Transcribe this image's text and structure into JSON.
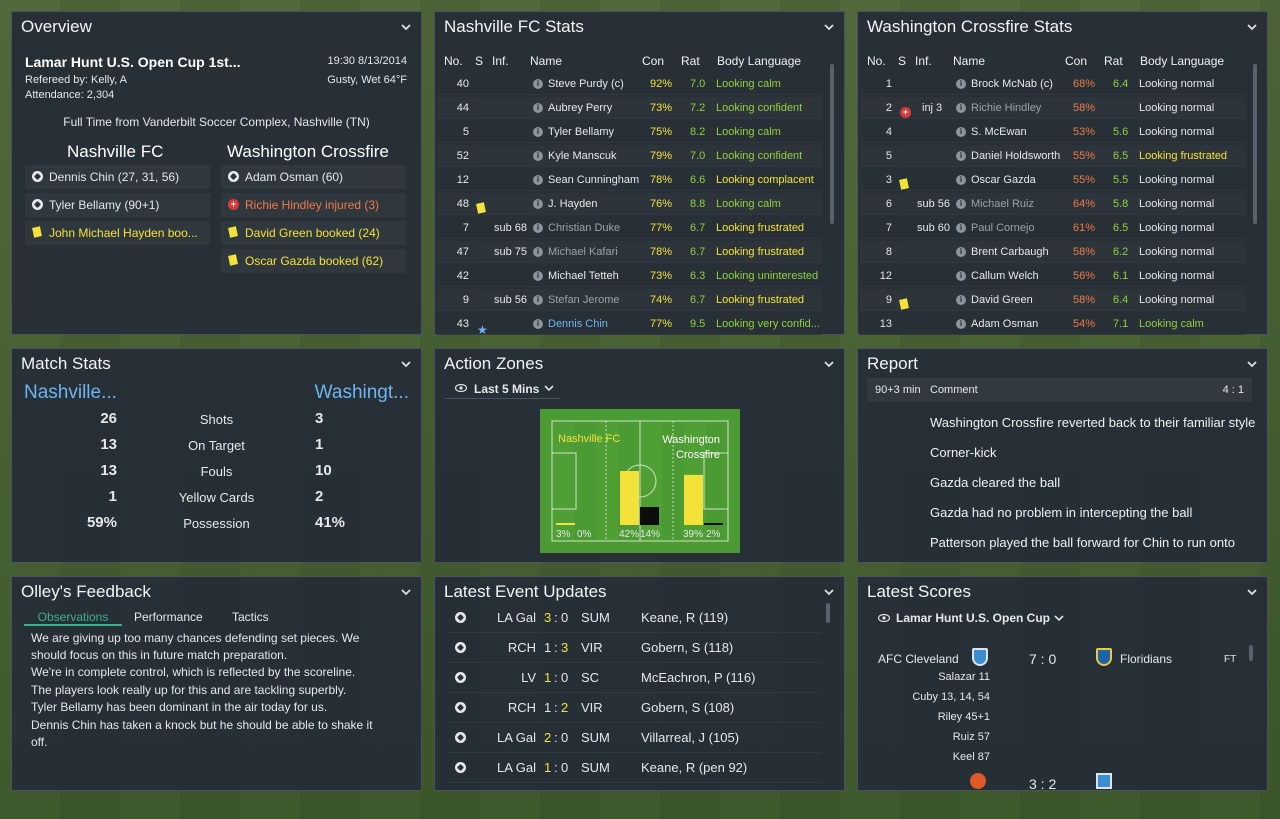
{
  "overview": {
    "title": "Overview",
    "competition": "Lamar Hunt U.S. Open Cup 1st...",
    "datetime": "19:30 8/13/2014",
    "referee": "Refereed by: Kelly, A",
    "weather": "Gusty, Wet 64°F",
    "attendance": "Attendance: 2,304",
    "result": "Full Time from Vanderbilt Soccer Complex, Nashville (TN)",
    "home_team": "Nashville FC",
    "away_team": "Washington Crossfire",
    "home_events": [
      {
        "icon": "ball-icon",
        "text": "Dennis Chin (27, 31, 56)"
      },
      {
        "icon": "ball-icon",
        "text": "Tyler Bellamy (90+1)"
      },
      {
        "icon": "yellow-card-icon",
        "text": "John Michael Hayden boo..."
      }
    ],
    "away_events": [
      {
        "icon": "ball-icon",
        "text": "Adam Osman (60)"
      },
      {
        "icon": "injury-icon",
        "text": "Richie Hindley injured (3)"
      },
      {
        "icon": "yellow-card-icon",
        "text": "David Green booked (24)"
      },
      {
        "icon": "yellow-card-icon",
        "text": "Oscar Gazda booked (62)"
      }
    ]
  },
  "columns": {
    "no": "No.",
    "s": "S",
    "inf": "Inf.",
    "name": "Name",
    "con": "Con",
    "rat": "Rat",
    "body": "Body Language"
  },
  "nashville_stats": {
    "title": "Nashville FC Stats",
    "rows": [
      {
        "no": "40",
        "s": "",
        "inf": "",
        "name": "Steve Purdy (c)",
        "con": "92%",
        "rat": "7.0",
        "body": "Looking calm",
        "sub": false
      },
      {
        "no": "44",
        "s": "",
        "inf": "",
        "name": "Aubrey Perry",
        "con": "73%",
        "rat": "7.2",
        "body": "Looking confident",
        "sub": false
      },
      {
        "no": "5",
        "s": "",
        "inf": "",
        "name": "Tyler Bellamy",
        "con": "75%",
        "rat": "8.2",
        "body": "Looking calm",
        "sub": false
      },
      {
        "no": "52",
        "s": "",
        "inf": "",
        "name": "Kyle Manscuk",
        "con": "79%",
        "rat": "7.0",
        "body": "Looking confident",
        "sub": false
      },
      {
        "no": "12",
        "s": "",
        "inf": "",
        "name": "Sean Cunningham",
        "con": "78%",
        "rat": "6.6",
        "body": "Looking complacent",
        "sub": false
      },
      {
        "no": "48",
        "s": "yellow-card-icon",
        "inf": "",
        "name": "J. Hayden",
        "con": "76%",
        "rat": "8.8",
        "body": "Looking calm",
        "sub": false
      },
      {
        "no": "7",
        "s": "",
        "inf": "sub 68",
        "name": "Christian Duke",
        "con": "77%",
        "rat": "6.7",
        "body": "Looking frustrated",
        "sub": true
      },
      {
        "no": "47",
        "s": "",
        "inf": "sub 75",
        "name": "Michael Kafari",
        "con": "78%",
        "rat": "6.7",
        "body": "Looking frustrated",
        "sub": true
      },
      {
        "no": "42",
        "s": "",
        "inf": "",
        "name": "Michael Tetteh",
        "con": "73%",
        "rat": "6.3",
        "body": "Looking uninterested",
        "sub": false
      },
      {
        "no": "9",
        "s": "",
        "inf": "sub 56",
        "name": "Stefan Jerome",
        "con": "74%",
        "rat": "6.7",
        "body": "Looking frustrated",
        "sub": true
      },
      {
        "no": "43",
        "s": "star-icon",
        "inf": "",
        "name": "Dennis Chin",
        "con": "77%",
        "rat": "9.5",
        "body": "Looking very confid...",
        "sub": false,
        "star": true
      }
    ]
  },
  "washington_stats": {
    "title": "Washington Crossfire Stats",
    "rows": [
      {
        "no": "1",
        "s": "",
        "inf": "",
        "name": "Brock McNab (c)",
        "con": "68%",
        "rat": "6.4",
        "body": "Looking normal",
        "sub": false
      },
      {
        "no": "2",
        "s": "injury-icon",
        "inf": "inj 3",
        "name": "Richie Hindley",
        "con": "58%",
        "rat": "",
        "body": "Looking normal",
        "sub": true
      },
      {
        "no": "4",
        "s": "",
        "inf": "",
        "name": "S. McEwan",
        "con": "53%",
        "rat": "5.6",
        "body": "Looking normal",
        "sub": false
      },
      {
        "no": "5",
        "s": "",
        "inf": "",
        "name": "Daniel Holdsworth",
        "con": "55%",
        "rat": "6.5",
        "body": "Looking frustrated",
        "sub": false
      },
      {
        "no": "3",
        "s": "yellow-card-icon",
        "inf": "",
        "name": "Oscar Gazda",
        "con": "55%",
        "rat": "5.5",
        "body": "Looking normal",
        "sub": false
      },
      {
        "no": "6",
        "s": "",
        "inf": "sub 56",
        "name": "Michael Ruiz",
        "con": "64%",
        "rat": "5.8",
        "body": "Looking normal",
        "sub": true
      },
      {
        "no": "7",
        "s": "",
        "inf": "sub 60",
        "name": "Paul Cornejo",
        "con": "61%",
        "rat": "6.5",
        "body": "Looking normal",
        "sub": true
      },
      {
        "no": "8",
        "s": "",
        "inf": "",
        "name": "Brent Carbaugh",
        "con": "58%",
        "rat": "6.2",
        "body": "Looking normal",
        "sub": false
      },
      {
        "no": "12",
        "s": "",
        "inf": "",
        "name": "Callum Welch",
        "con": "56%",
        "rat": "6.1",
        "body": "Looking normal",
        "sub": false
      },
      {
        "no": "9",
        "s": "yellow-card-icon",
        "inf": "",
        "name": "David Green",
        "con": "58%",
        "rat": "6.4",
        "body": "Looking normal",
        "sub": false
      },
      {
        "no": "13",
        "s": "",
        "inf": "",
        "name": "Adam Osman",
        "con": "54%",
        "rat": "7.1",
        "body": "Looking calm",
        "sub": false
      }
    ]
  },
  "match_stats": {
    "title": "Match Stats",
    "home": "Nashville...",
    "away": "Washingt...",
    "rows": [
      {
        "home": "26",
        "label": "Shots",
        "away": "3"
      },
      {
        "home": "13",
        "label": "On Target",
        "away": "1"
      },
      {
        "home": "13",
        "label": "Fouls",
        "away": "10"
      },
      {
        "home": "1",
        "label": "Yellow Cards",
        "away": "2"
      },
      {
        "home": "59%",
        "label": "Possession",
        "away": "41%"
      }
    ]
  },
  "action_zones": {
    "title": "Action Zones",
    "filter": "Last 5 Mins",
    "home_label": "Nashville FC",
    "away_label": "Washington Crossfire",
    "zones": [
      {
        "home_pct": 3,
        "away_pct": 0,
        "home_label": "3%",
        "away_label": "0%"
      },
      {
        "home_pct": 42,
        "away_pct": 14,
        "home_label": "42%",
        "away_label": "14%"
      },
      {
        "home_pct": 39,
        "away_pct": 2,
        "home_label": "39%",
        "away_label": "2%"
      }
    ]
  },
  "report": {
    "title": "Report",
    "time": "90+3 min",
    "header": "Comment",
    "score": "4 : 1",
    "lines": [
      "Washington Crossfire reverted back to their familiar style",
      "Corner-kick",
      "Gazda cleared the ball",
      "Gazda had no problem in intercepting the ball",
      "Patterson played the ball forward for Chin to run onto"
    ]
  },
  "feedback": {
    "title": "Olley's Feedback",
    "tabs": [
      "Observations",
      "Performance",
      "Tactics"
    ],
    "lines": [
      "We are giving up too many chances defending set pieces. We",
      "should focus on this in future match preparation.",
      "We're in complete control, which is reflected by the scoreline.",
      "The players look really up for this and are tackling superbly.",
      "Tyler Bellamy has been dominant in the air today for us.",
      "Dennis Chin has taken a knock but he should be able to shake it",
      "off."
    ]
  },
  "events": {
    "title": "Latest Event Updates",
    "rows": [
      {
        "home": "LA Gal",
        "hs": "3",
        "as": "0",
        "away": "SUM",
        "scorer": "Keane, R (119)",
        "hl": "home"
      },
      {
        "home": "RCH",
        "hs": "1",
        "as": "3",
        "away": "VIR",
        "scorer": "Gobern, S (118)",
        "hl": "away"
      },
      {
        "home": "LV",
        "hs": "1",
        "as": "0",
        "away": "SC",
        "scorer": "McEachron, P (116)",
        "hl": "home"
      },
      {
        "home": "RCH",
        "hs": "1",
        "as": "2",
        "away": "VIR",
        "scorer": "Gobern, S (108)",
        "hl": "away"
      },
      {
        "home": "LA Gal",
        "hs": "2",
        "as": "0",
        "away": "SUM",
        "scorer": "Villarreal, J (105)",
        "hl": "home"
      },
      {
        "home": "LA Gal",
        "hs": "1",
        "as": "0",
        "away": "SUM",
        "scorer": "Keane, R (pen 92)",
        "hl": "home"
      }
    ]
  },
  "scores": {
    "title": "Latest Scores",
    "competition": "Lamar Hunt U.S. Open Cup",
    "match": {
      "home": "AFC Cleveland",
      "score": "7 : 0",
      "away": "Floridians",
      "status": "FT"
    },
    "scorers": [
      "Salazar 11",
      "Cuby 13, 14, 54",
      "Riley 45+1",
      "Ruiz 57",
      "Keel 87"
    ],
    "next_score": "3 : 2"
  }
}
